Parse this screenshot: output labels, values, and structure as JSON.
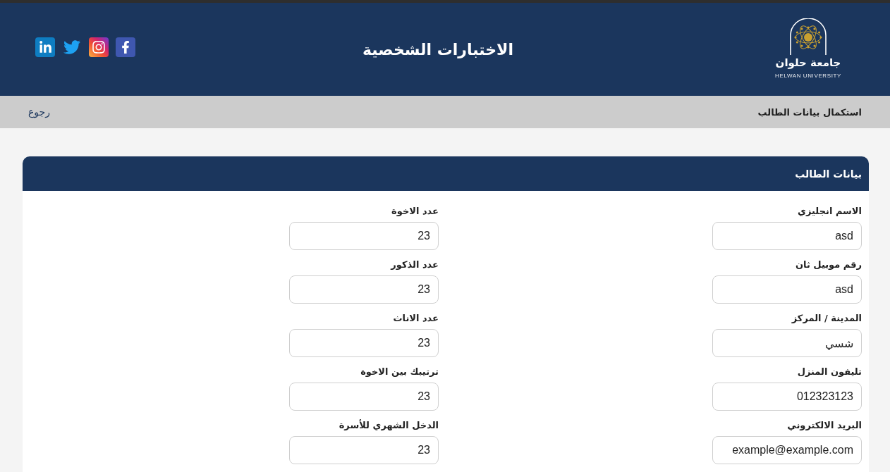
{
  "header": {
    "logo": {
      "name_ar": "جامعة حلوان",
      "name_en": "HELWAN UNIVERSITY"
    },
    "title": "الاختبارات الشخصية"
  },
  "breadcrumb_bar": {
    "page_title": "استكمال بيانات الطالب",
    "back_link": "رجوع"
  },
  "card": {
    "title": "بيانات الطالب",
    "fields": [
      {
        "label": "الاسم انجليزي",
        "value": "asd"
      },
      {
        "label": "عدد الاخوة",
        "value": "23"
      },
      {
        "label": "رقم موبيل ثان",
        "value": "asd"
      },
      {
        "label": "عدد الذكور",
        "value": "23"
      },
      {
        "label": "المدينة / المركز",
        "value": "شسي"
      },
      {
        "label": "عدد الاناث",
        "value": "23"
      },
      {
        "label": "تليفون المنزل",
        "value": "012323123"
      },
      {
        "label": "ترتيبك بين الاخوة",
        "value": "23"
      },
      {
        "label": "البريد الالكتروني",
        "value": "example@example.com"
      },
      {
        "label": "الدخل الشهري للأسرة",
        "value": "23"
      }
    ]
  }
}
